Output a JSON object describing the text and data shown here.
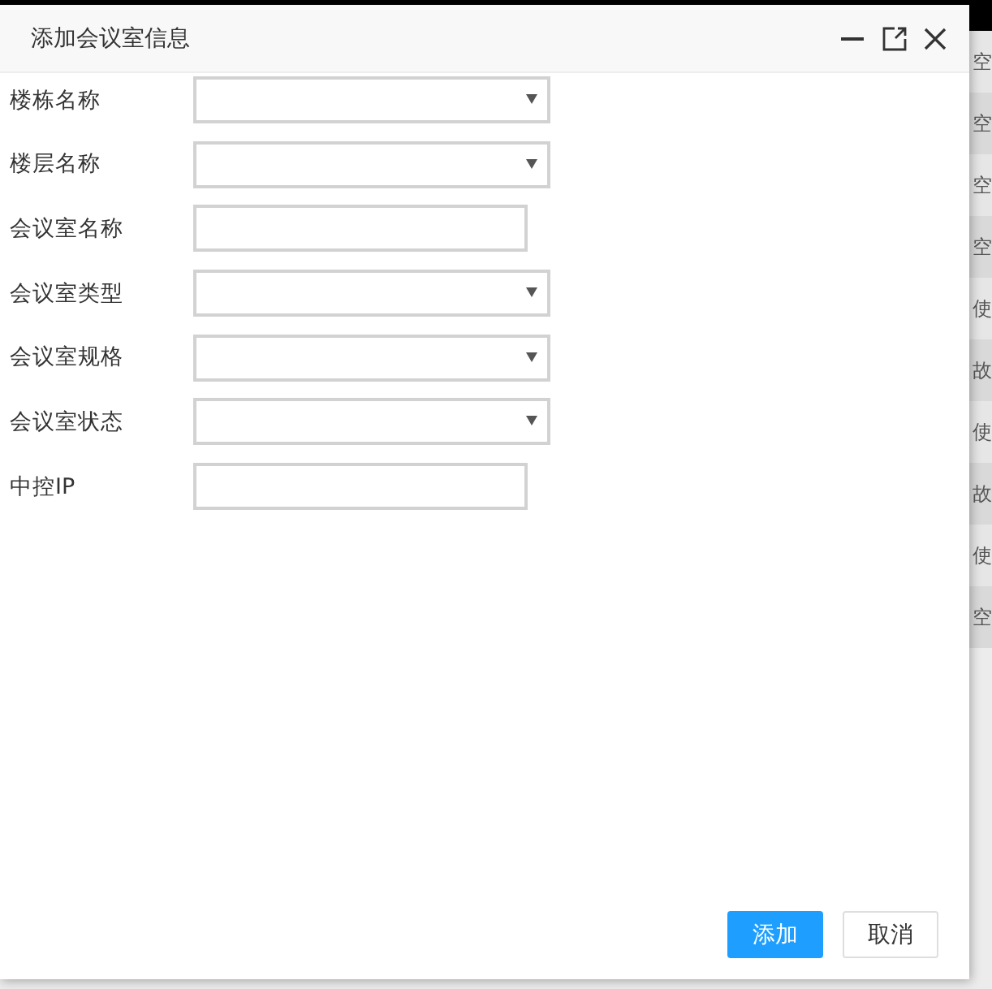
{
  "background_table": {
    "cells": [
      "空",
      "空",
      "空",
      "空",
      "使",
      "故",
      "使",
      "故",
      "使",
      "空"
    ]
  },
  "dialog": {
    "title": "添加会议室信息",
    "fields": [
      {
        "label": "楼栋名称",
        "kind": "select"
      },
      {
        "label": "楼层名称",
        "kind": "select"
      },
      {
        "label": "会议室名称",
        "kind": "text"
      },
      {
        "label": "会议室类型",
        "kind": "select"
      },
      {
        "label": "会议室规格",
        "kind": "select"
      },
      {
        "label": "会议室状态",
        "kind": "select"
      },
      {
        "label": "中控IP",
        "kind": "text"
      }
    ],
    "buttons": [
      {
        "label": "添加",
        "kind": "primary"
      },
      {
        "label": "取消",
        "kind": "secondary"
      }
    ]
  }
}
